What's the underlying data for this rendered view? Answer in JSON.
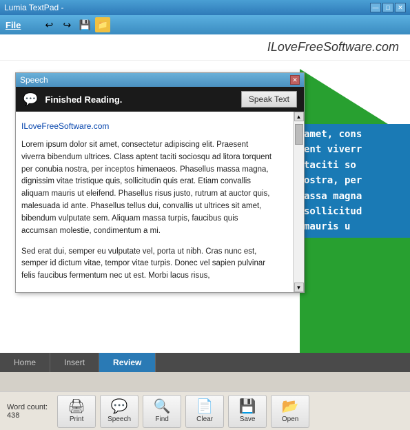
{
  "titleBar": {
    "title": "Lumia TextPad -",
    "controls": [
      "—",
      "□",
      "✕"
    ]
  },
  "menuBar": {
    "fileLabel": "File",
    "toolbarIcons": [
      "undo",
      "redo",
      "save",
      "folder"
    ]
  },
  "websiteBanner": {
    "text": "ILoveFreeSoftware.com"
  },
  "speechDialog": {
    "title": "Speech",
    "closeLabel": "✕",
    "statusText": "Finished Reading.",
    "speakTextLabel": "Speak Text",
    "websiteLink": "ILoveFreeSoftware.com",
    "bodyParagraph1": "Lorem ipsum dolor sit amet, consectetur adipiscing elit. Praesent viverra bibendum ultrices. Class aptent taciti sociosqu ad litora torquent per conubia nostra, per inceptos himenaeos. Phasellus massa magna, dignissim vitae tristique quis, sollicitudin quis erat. Etiam convallis aliquam mauris ut eleifend. Phasellus risus justo, rutrum at auctor quis, malesuada id ante. Phasellus tellus dui, convallis ut ultrices sit amet, bibendum vulputate sem. Aliquam massa turpis, faucibus quis accumsan molestie, condimentum a mi.",
    "bodyParagraph2": "Sed erat dui, semper eu vulputate vel, porta ut nibh. Cras nunc est, semper id dictum vitae, tempor vitae turpis. Donec vel sapien pulvinar felis faucibus fermentum nec ut est. Morbi lacus risus,"
  },
  "blueTextLines": [
    "amet, cons",
    "ent viverr",
    "taciti so",
    "ostra, per",
    "assa magna",
    "sollicitud",
    "mauris u"
  ],
  "tabs": [
    {
      "label": "Home",
      "active": false
    },
    {
      "label": "Insert",
      "active": false
    },
    {
      "label": "Review",
      "active": true
    }
  ],
  "bottomToolbar": {
    "wordCountLabel": "Word count:",
    "wordCountValue": "438",
    "buttons": [
      {
        "label": "Print",
        "icon": "🖨",
        "name": "print-button"
      },
      {
        "label": "Speech",
        "icon": "💬",
        "name": "speech-button"
      },
      {
        "label": "Find",
        "icon": "🔍",
        "name": "find-button"
      },
      {
        "label": "Clear",
        "icon": "📄",
        "name": "clear-button"
      },
      {
        "label": "Save",
        "icon": "💾",
        "name": "save-button"
      },
      {
        "label": "Open",
        "icon": "📂",
        "name": "open-button"
      }
    ]
  }
}
